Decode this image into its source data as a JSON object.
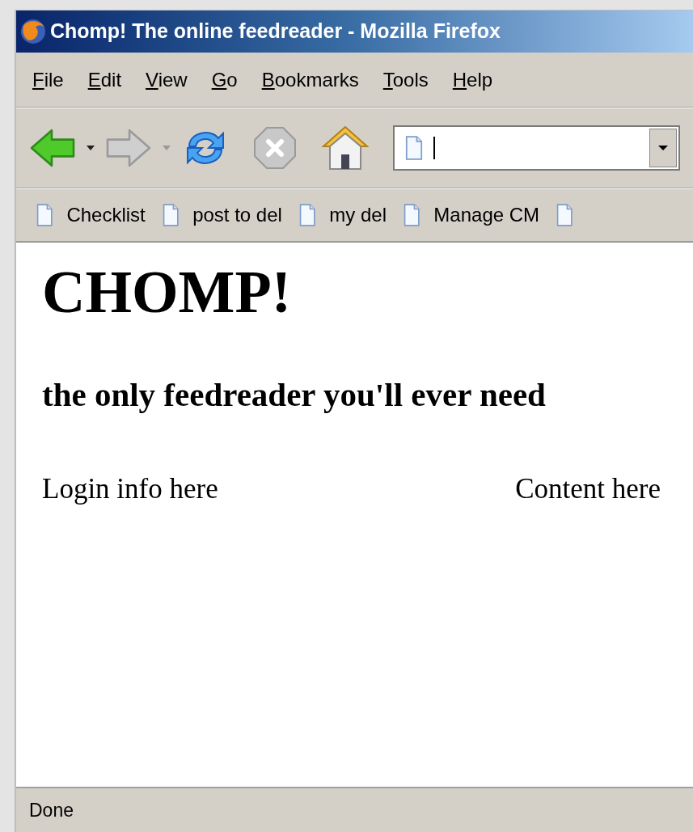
{
  "window": {
    "title": "Chomp! The online feedreader - Mozilla Firefox"
  },
  "menu": [
    {
      "label": "File"
    },
    {
      "label": "Edit"
    },
    {
      "label": "View"
    },
    {
      "label": "Go"
    },
    {
      "label": "Bookmarks"
    },
    {
      "label": "Tools"
    },
    {
      "label": "Help"
    }
  ],
  "navigation": {
    "back": {
      "disabled": false
    },
    "forward": {
      "disabled": true
    }
  },
  "bookmarks": [
    {
      "label": "Checklist"
    },
    {
      "label": "post to del"
    },
    {
      "label": "my del"
    },
    {
      "label": "Manage CM"
    }
  ],
  "page": {
    "heading": "CHOMP!",
    "subheading": "the only feedreader you'll ever need",
    "login": "Login info here",
    "content": "Content here"
  },
  "status_bar": {
    "text": "Done"
  }
}
